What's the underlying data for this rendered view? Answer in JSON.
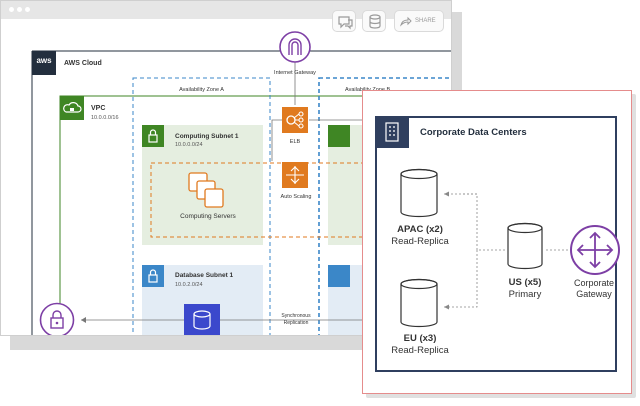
{
  "toolbar": {
    "icons": [
      "comment-icon",
      "database-icon",
      "share-icon"
    ],
    "share_label": "SHARE"
  },
  "aws": {
    "logo": "aws",
    "cloud_label": "AWS Cloud",
    "vpc_label": "VPC",
    "vpc_cidr": "10.0.0.0/16",
    "az_a_label": "Availability Zone A",
    "az_b_label": "Availability Zone B",
    "internet_gateway": "Internet Gateway",
    "elb": "ELB",
    "auto_scaling": "Auto Scaling",
    "computing_subnet": {
      "name": "Computing Subnet 1",
      "cidr": "10.0.0.0/24"
    },
    "computing_servers": "Computing Servers",
    "database_subnet": {
      "name": "Database Subnet 1",
      "cidr": "10.0.2.0/24"
    },
    "sync_replication": "Synchronous Replication"
  },
  "corporate": {
    "title": "Corporate Data Centers",
    "apac": {
      "name": "APAC (x2)",
      "role": "Read-Replica"
    },
    "eu": {
      "name": "EU (x3)",
      "role": "Read-Replica"
    },
    "us": {
      "name": "US (x5)",
      "role": "Primary"
    },
    "gateway": "Corporate Gateway"
  },
  "colors": {
    "aws_dark": "#232f3e",
    "az_blue": "#3b87c8",
    "vpc_green": "#3f8624",
    "subnet_green_fill": "#e5eee0",
    "subnet_blue_fill": "#e3ecf5",
    "orange": "#e07a1f",
    "purple": "#7d3fa5",
    "navy": "#2f3f5f",
    "red_border": "#e58c8c"
  }
}
